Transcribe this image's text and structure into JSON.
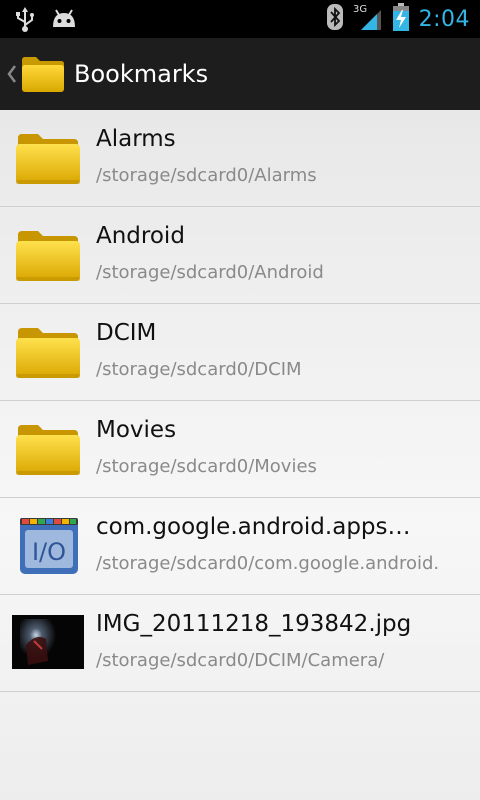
{
  "status_bar": {
    "time": "2:04",
    "network": "3G",
    "icons": [
      "usb-icon",
      "android-debug-icon",
      "bluetooth-icon",
      "signal-icon",
      "battery-charging-icon"
    ],
    "clock_color": "#33b5e5"
  },
  "action_bar": {
    "title": "Bookmarks",
    "icon": "folder-icon"
  },
  "bookmarks": [
    {
      "name": "Alarms",
      "path": "/storage/sdcard0/Alarms",
      "icon": "folder-icon"
    },
    {
      "name": "Android",
      "path": "/storage/sdcard0/Android",
      "icon": "folder-icon"
    },
    {
      "name": "DCIM",
      "path": "/storage/sdcard0/DCIM",
      "icon": "folder-icon"
    },
    {
      "name": "Movies",
      "path": "/storage/sdcard0/Movies",
      "icon": "folder-icon"
    },
    {
      "name": "com.google.android.apps…",
      "path": "/storage/sdcard0/com.google.android.",
      "icon": "app-io-icon"
    },
    {
      "name": "IMG_20111218_193842.jpg",
      "path": "/storage/sdcard0/DCIM/Camera/",
      "icon": "image-thumbnail"
    }
  ],
  "colors": {
    "folder_yellow": "#f2c600",
    "action_bar_bg": "#1d1d1d"
  }
}
